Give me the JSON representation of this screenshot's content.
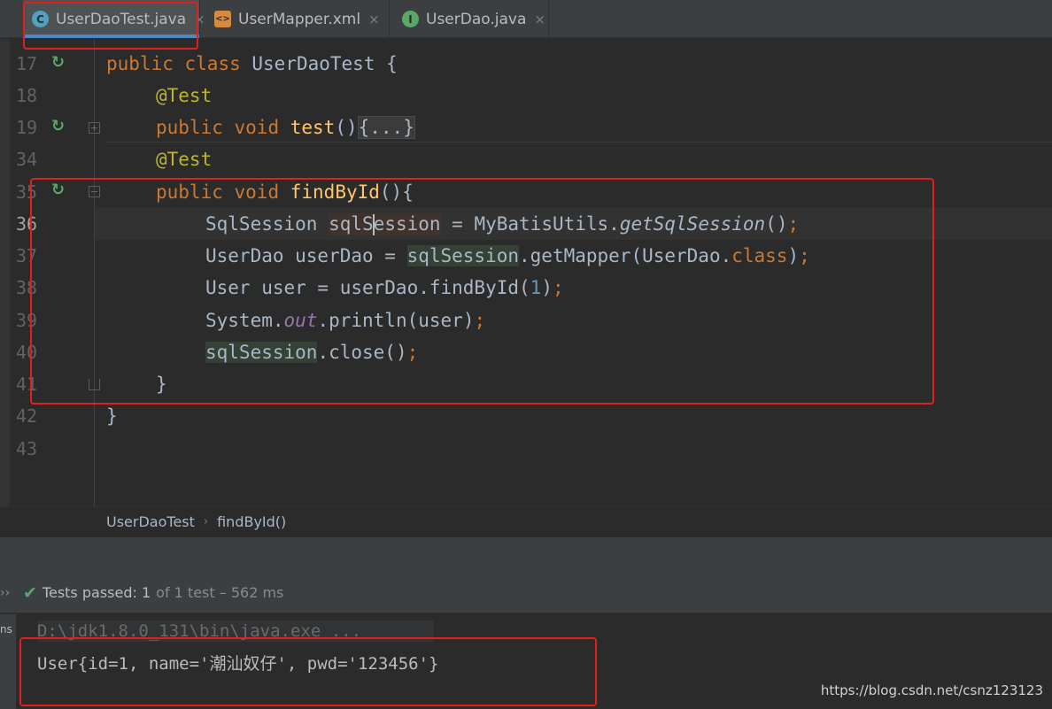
{
  "tabs": [
    {
      "label": "UserDaoTest.java",
      "icon": "C",
      "icon_color": "#4fa1c2",
      "active": true
    },
    {
      "label": "UserMapper.xml",
      "icon": "<>",
      "icon_color": "#d58a40",
      "active": false
    },
    {
      "label": "UserDao.java",
      "icon": "I",
      "icon_color": "#59a869",
      "active": false
    }
  ],
  "close_glyph": "×",
  "line_numbers": [
    "17",
    "18",
    "19",
    "34",
    "35",
    "36",
    "37",
    "38",
    "39",
    "40",
    "41",
    "42",
    "43"
  ],
  "code": {
    "l17": {
      "kw1": "public",
      "kw2": "class",
      "name": "UserDaoTest",
      "brace": "{"
    },
    "l18": {
      "ann": "@Test"
    },
    "l19": {
      "kw1": "public",
      "kw2": "void",
      "fn": "test",
      "paren": "()",
      "folded": "{...}"
    },
    "l34": {
      "ann": "@Test"
    },
    "l35": {
      "kw1": "public",
      "kw2": "void",
      "fn": "findById",
      "tail": "(){"
    },
    "l36": {
      "type": "SqlSession",
      "var_a": "sqlS",
      "var_b": "ession",
      "eq": " = MyBatisUtils.",
      "call": "getSqlSession",
      "tail": "()",
      "semi": ";"
    },
    "l37": {
      "lhs": "UserDao userDao = ",
      "var": "sqlSession",
      "mid": ".getMapper(UserDao.",
      "kw": "class",
      "tail": ")",
      "semi": ";"
    },
    "l38": {
      "lhs": "User user = userDao.findById(",
      "num": "1",
      "tail": ")",
      "semi": ";"
    },
    "l39": {
      "lhs": "System.",
      "static": "out",
      "tail": ".println(user)",
      "semi": ";"
    },
    "l40": {
      "var": "sqlSession",
      "tail": ".close()",
      "semi": ";"
    },
    "l41": {
      "brace": "}"
    },
    "l42": {
      "brace": "}"
    }
  },
  "breadcrumb": {
    "class": "UserDaoTest",
    "method": "findById()",
    "separator": "›"
  },
  "tests": {
    "status": "Tests passed:",
    "count": "1",
    "detail": "of 1 test – 562 ms"
  },
  "run_side_label": "ns",
  "console": {
    "command": "D:\\jdk1.8.0_131\\bin\\java.exe ...",
    "output": "User{id=1, name='潮汕奴仔', pwd='123456'}"
  },
  "watermark": "https://blog.csdn.net/csnz123123",
  "colors": {
    "annotation_box": "#e0211b",
    "keyword": "#cc7832",
    "function": "#ffc66d",
    "annotation": "#bbb529"
  }
}
